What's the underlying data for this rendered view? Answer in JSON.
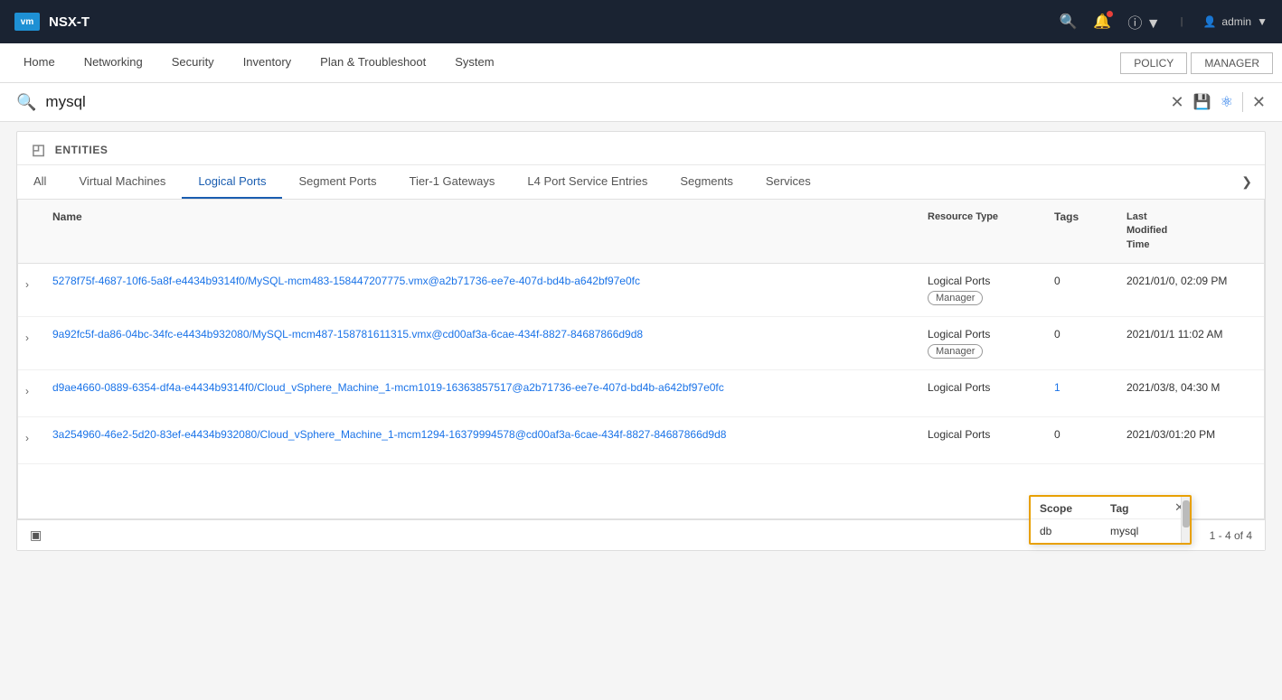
{
  "topbar": {
    "logo_text": "vm",
    "app_name": "NSX-T",
    "search_tooltip": "search",
    "bell_tooltip": "notifications",
    "help_tooltip": "help",
    "user_label": "admin",
    "dropdown_arrow": "▾"
  },
  "navbar": {
    "items": [
      {
        "id": "home",
        "label": "Home",
        "active": false
      },
      {
        "id": "networking",
        "label": "Networking",
        "active": false
      },
      {
        "id": "security",
        "label": "Security",
        "active": false
      },
      {
        "id": "inventory",
        "label": "Inventory",
        "active": false
      },
      {
        "id": "plan_troubleshoot",
        "label": "Plan & Troubleshoot",
        "active": false
      },
      {
        "id": "system",
        "label": "System",
        "active": false
      }
    ],
    "mode_policy": "POLICY",
    "mode_manager": "MANAGER"
  },
  "searchbar": {
    "query": "mysql",
    "placeholder": "Search",
    "clear_icon": "✕",
    "filter_icon": "⚙",
    "save_icon": "💾",
    "close_icon": "✕"
  },
  "entities": {
    "header": "ENTITIES",
    "tabs": [
      {
        "id": "all",
        "label": "All",
        "active": false
      },
      {
        "id": "virtual_machines",
        "label": "Virtual Machines",
        "active": false
      },
      {
        "id": "logical_ports",
        "label": "Logical Ports",
        "active": true
      },
      {
        "id": "segment_ports",
        "label": "Segment Ports",
        "active": false
      },
      {
        "id": "tier1_gateways",
        "label": "Tier-1 Gateways",
        "active": false
      },
      {
        "id": "l4_port_service_entries",
        "label": "L4 Port Service Entries",
        "active": false
      },
      {
        "id": "segments",
        "label": "Segments",
        "active": false
      },
      {
        "id": "services",
        "label": "Services",
        "active": false
      }
    ]
  },
  "table": {
    "columns": {
      "expand": "",
      "name": "Name",
      "resource_type": "Resource Type",
      "tags": "Tags",
      "last_modified": "Last Modified Time"
    },
    "rows": [
      {
        "id": "row1",
        "name": "5278f75f-4687-10f6-5a8f-e4434b9314f0/MySQL-mcm483-158447207775.vmx@a2b71736-ee7e-407d-bd4b-a642bf97e0fc",
        "resource_type": "Logical Ports",
        "badge": "Manager",
        "tags": "0",
        "tags_count": 0,
        "last_modified": "2021/01/0, 02:09 PM"
      },
      {
        "id": "row2",
        "name": "9a92fc5f-da86-04bc-34fc-e4434b932080/MySQL-mcm487-158781611315.vmx@cd00af3a-6cae-434f-8827-84687866d9d8",
        "resource_type": "Logical Ports",
        "badge": "Manager",
        "tags": "0",
        "tags_count": 0,
        "last_modified": "2021/01/1 11:02 AM"
      },
      {
        "id": "row3",
        "name": "d9ae4660-0889-6354-df4a-e4434b9314f0/Cloud_vSphere_Machine_1-mcm1019-16363857517@a2b71736-ee7e-407d-bd4b-a642bf97e0fc",
        "resource_type": "Logical Ports",
        "badge": null,
        "tags": "1",
        "tags_count": 1,
        "last_modified": "2021/03/8, 04:30 M"
      },
      {
        "id": "row4",
        "name": "3a254960-46e2-5d20-83ef-e4434b932080/Cloud_vSphere_Machine_1-mcm1294-16379994578@cd00af3a-6cae-434f-8827-84687866d9d8",
        "resource_type": "Logical Ports",
        "badge": null,
        "tags": "0",
        "tags_count": 0,
        "last_modified": "2021/03/01:20 PM"
      }
    ],
    "pagination": "1 - 4 of 4"
  },
  "tag_popup": {
    "scope_label": "Scope",
    "tag_label": "Tag",
    "scope_value": "db",
    "tag_value": "mysql",
    "close": "✕"
  }
}
